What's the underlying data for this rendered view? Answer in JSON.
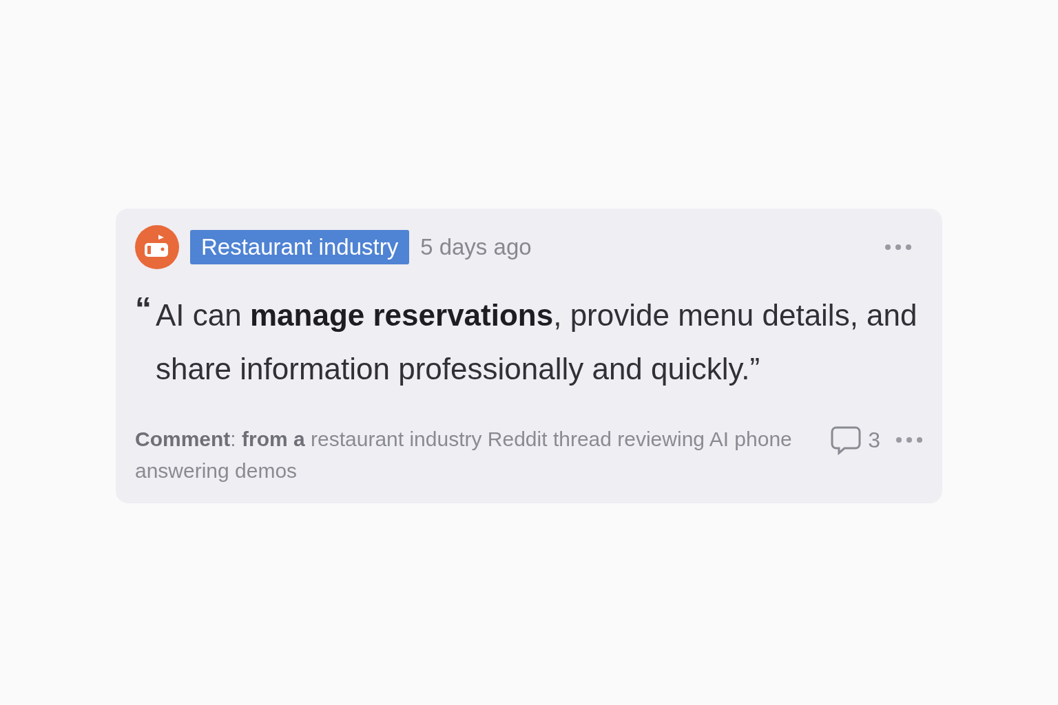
{
  "post": {
    "tag": "Restaurant industry",
    "time": "5 days ago",
    "quote": {
      "open_mark": "“",
      "text": "AI can **manage reservations**, provide menu details, and share information professionally and quickly.”"
    },
    "caption": "**Comment**: **from a** restaurant industry Reddit thread reviewing AI phone answering demos",
    "comment_count": "3"
  }
}
